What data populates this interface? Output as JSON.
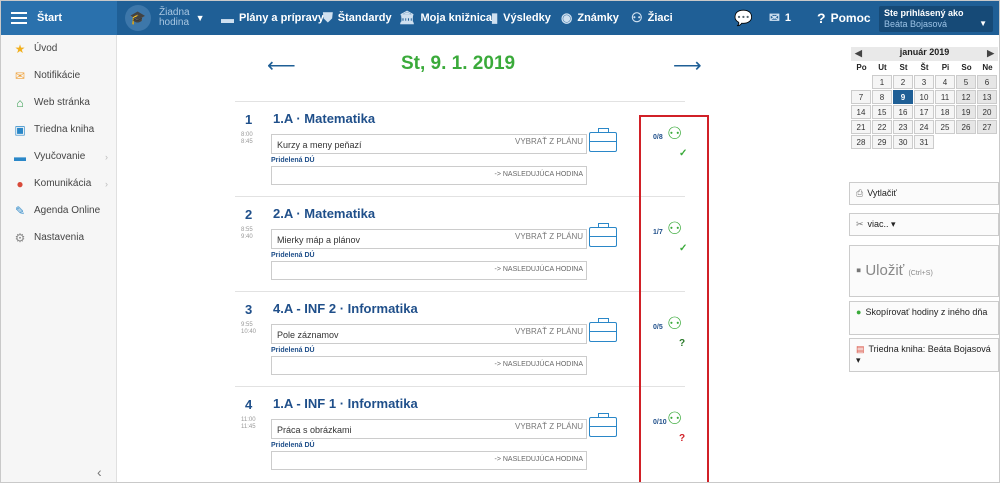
{
  "topbar": {
    "start": "Štart",
    "hodina_line1": "Žiadna",
    "hodina_line2": "hodina",
    "plany": "Plány a prípravy",
    "standardy": "Štandardy",
    "kniznica": "Moja knižnica",
    "vysledky": "Výsledky",
    "znamky": "Známky",
    "ziaci": "Žiaci",
    "mail_count": "1",
    "pomoc": "Pomoc",
    "user_label": "Ste prihlásený ako",
    "user_name": "Beáta Bojasová"
  },
  "sidebar": {
    "items": [
      {
        "label": "Úvod",
        "icon": "star-icon",
        "color": "#f2b01e"
      },
      {
        "label": "Notifikácie",
        "icon": "envelope-icon",
        "color": "#f0a23a"
      },
      {
        "label": "Web stránka",
        "icon": "home-icon",
        "color": "#2e9a4a"
      },
      {
        "label": "Triedna kniha",
        "icon": "book-icon",
        "color": "#2a87c8"
      },
      {
        "label": "Vyučovanie",
        "icon": "briefcase-icon",
        "color": "#2a87c8"
      },
      {
        "label": "Komunikácia",
        "icon": "chat-icon",
        "color": "#d84a3a"
      },
      {
        "label": "Agenda Online",
        "icon": "pen-icon",
        "color": "#2a87c8"
      },
      {
        "label": "Nastavenia",
        "icon": "gear-icon",
        "color": "#888888"
      }
    ]
  },
  "main": {
    "date": "St, 9. 1. 2019",
    "lessons": [
      {
        "num": "1",
        "t1": "8:00",
        "t2": "8:45",
        "title": "1.A · Matematika",
        "topic": "Kurzy a meny peňazí",
        "vybrat": "VYBRAŤ Z PLÁNU",
        "du": "Pridelená DÚ",
        "next": "-> NASLEDUJÚCA HODINA",
        "att": "0/8",
        "mark": "✓",
        "mark_color": "#3aaa3a"
      },
      {
        "num": "2",
        "t1": "8:55",
        "t2": "9:40",
        "title": "2.A · Matematika",
        "topic": "Mierky máp a plánov",
        "vybrat": "VYBRAŤ Z PLÁNU",
        "du": "Pridelená DÚ",
        "next": "-> NASLEDUJÚCA HODINA",
        "att": "1/7",
        "mark": "✓",
        "mark_color": "#3aaa3a"
      },
      {
        "num": "3",
        "t1": "9:55",
        "t2": "10:40",
        "title": "4.A - INF 2 · Informatika",
        "topic": "Pole záznamov",
        "vybrat": "VYBRAŤ Z PLÁNU",
        "du": "Pridelená DÚ",
        "next": "-> NASLEDUJÚCA HODINA",
        "att": "0/5",
        "mark": "?",
        "mark_color": "#2a7a2a"
      },
      {
        "num": "4",
        "t1": "11:00",
        "t2": "11:45",
        "title": "1.A - INF 1 · Informatika",
        "topic": "Práca s obrázkami",
        "vybrat": "VYBRAŤ Z PLÁNU",
        "du": "Pridelená DÚ",
        "next": "-> NASLEDUJÚCA HODINA",
        "att": "0/10",
        "mark": "?",
        "mark_color": "#d12027"
      }
    ]
  },
  "calendar": {
    "month": "január 2019",
    "dow": [
      "Po",
      "Ut",
      "St",
      "Št",
      "Pi",
      "So",
      "Ne"
    ],
    "weeks": [
      [
        "",
        "1",
        "2",
        "3",
        "4",
        "5",
        "6"
      ],
      [
        "7",
        "8",
        "9",
        "10",
        "11",
        "12",
        "13"
      ],
      [
        "14",
        "15",
        "16",
        "17",
        "18",
        "19",
        "20"
      ],
      [
        "21",
        "22",
        "23",
        "24",
        "25",
        "26",
        "27"
      ],
      [
        "28",
        "29",
        "30",
        "31",
        "",
        "",
        ""
      ]
    ],
    "today": "9"
  },
  "right": {
    "vytlacit": "Vytlačiť",
    "viac": "viac.. ▾",
    "ulozit": "Uložiť",
    "ulozit_hint": "(Ctrl+S)",
    "kopirovat": "Skopírovať hodiny z iného dňa",
    "triedna": "Triedna kniha: Beáta Bojasová ▾"
  }
}
